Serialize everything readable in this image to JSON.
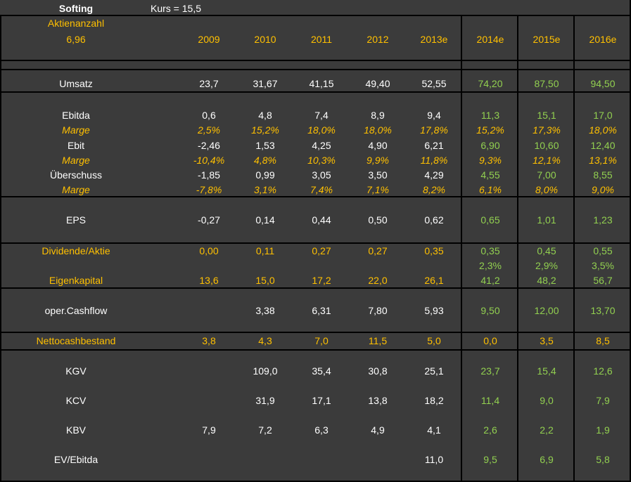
{
  "header": {
    "title": "Softing",
    "kurs": "Kurs = 15,5",
    "shares_label": "Aktienanzahl",
    "shares_value": "6,96",
    "years": [
      "2009",
      "2010",
      "2011",
      "2012",
      "2013e",
      "2014e",
      "2015e",
      "2016e"
    ]
  },
  "rows": [
    {
      "label": "Umsatz",
      "values": [
        "23,7",
        "31,67",
        "41,15",
        "49,40",
        "52,55",
        "74,20",
        "87,50",
        "94,50"
      ]
    },
    {
      "label": "Ebitda",
      "values": [
        "0,6",
        "4,8",
        "7,4",
        "8,9",
        "9,4",
        "11,3",
        "15,1",
        "17,0"
      ]
    },
    {
      "label": "Marge",
      "values": [
        "2,5%",
        "15,2%",
        "18,0%",
        "18,0%",
        "17,8%",
        "15,2%",
        "17,3%",
        "18,0%"
      ]
    },
    {
      "label": "Ebit",
      "values": [
        "-2,46",
        "1,53",
        "4,25",
        "4,90",
        "6,21",
        "6,90",
        "10,60",
        "12,40"
      ]
    },
    {
      "label": "Marge",
      "values": [
        "-10,4%",
        "4,8%",
        "10,3%",
        "9,9%",
        "11,8%",
        "9,3%",
        "12,1%",
        "13,1%"
      ]
    },
    {
      "label": "Überschuss",
      "values": [
        "-1,85",
        "0,99",
        "3,05",
        "3,50",
        "4,29",
        "4,55",
        "7,00",
        "8,55"
      ]
    },
    {
      "label": "Marge",
      "values": [
        "-7,8%",
        "3,1%",
        "7,4%",
        "7,1%",
        "8,2%",
        "6,1%",
        "8,0%",
        "9,0%"
      ]
    },
    {
      "label": "EPS",
      "values": [
        "-0,27",
        "0,14",
        "0,44",
        "0,50",
        "0,62",
        "0,65",
        "1,01",
        "1,23"
      ]
    },
    {
      "label": "Dividende/Aktie",
      "values": [
        "0,00",
        "0,11",
        "0,27",
        "0,27",
        "0,35",
        "0,35",
        "0,45",
        "0,55"
      ]
    },
    {
      "label": "",
      "values": [
        "",
        "",
        "",
        "",
        "",
        "2,3%",
        "2,9%",
        "3,5%"
      ]
    },
    {
      "label": "Eigenkapital",
      "values": [
        "13,6",
        "15,0",
        "17,2",
        "22,0",
        "26,1",
        "41,2",
        "48,2",
        "56,7"
      ]
    },
    {
      "label": "oper.Cashflow",
      "values": [
        "",
        "3,38",
        "6,31",
        "7,80",
        "5,93",
        "9,50",
        "12,00",
        "13,70"
      ]
    },
    {
      "label": "Nettocashbestand",
      "values": [
        "3,8",
        "4,3",
        "7,0",
        "11,5",
        "5,0",
        "0,0",
        "3,5",
        "8,5"
      ]
    },
    {
      "label": "KGV",
      "values": [
        "",
        "109,0",
        "35,4",
        "30,8",
        "25,1",
        "23,7",
        "15,4",
        "12,6"
      ]
    },
    {
      "label": "KCV",
      "values": [
        "",
        "31,9",
        "17,1",
        "13,8",
        "18,2",
        "11,4",
        "9,0",
        "7,9"
      ]
    },
    {
      "label": "KBV",
      "values": [
        "7,9",
        "7,2",
        "6,3",
        "4,9",
        "4,1",
        "2,6",
        "2,2",
        "1,9"
      ]
    },
    {
      "label": "EV/Ebitda",
      "values": [
        "",
        "",
        "",
        "",
        "11,0",
        "9,5",
        "6,9",
        "5,8"
      ]
    }
  ],
  "colors": {
    "background": "#3b3b3b",
    "grid": "#000000",
    "text": "#ffffff",
    "accent_yellow": "#ffc000",
    "forecast_green": "#92d050"
  }
}
